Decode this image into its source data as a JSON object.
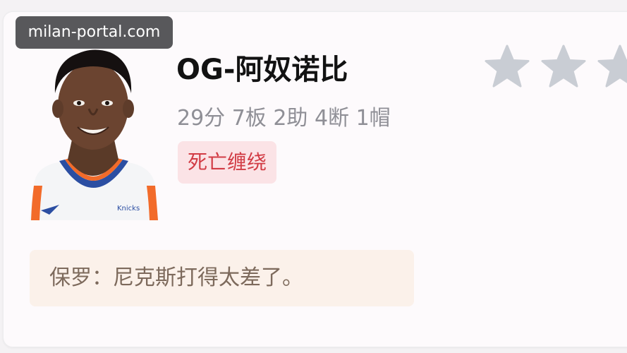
{
  "watermark": {
    "text": "milan-portal.com"
  },
  "player": {
    "name": "OG-阿奴诺比",
    "stats": "29分 7板 2助 4断 1帽",
    "tag": "死亡缠绕",
    "jersey_text": "Knicks"
  },
  "rating": {
    "icon": "star-icon",
    "star_color": "#c9cdd4"
  },
  "comment": {
    "text": "保罗：尼克斯打得太差了。"
  },
  "colors": {
    "tag_bg": "#fbe3e6",
    "tag_text": "#d23c45",
    "quote_bg": "#fbf1ea",
    "quote_text": "#7d6a5c",
    "jersey_trim": "#2b4ea2",
    "jersey_accent": "#f26b2a"
  }
}
